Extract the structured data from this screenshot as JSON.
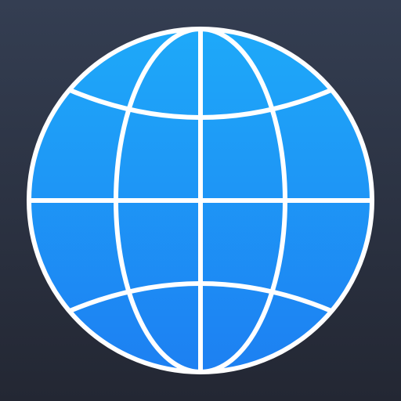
{
  "icon": {
    "name": "globe-icon",
    "colors": {
      "background_top": "#343e52",
      "background_bottom": "#232733",
      "globe_top": "#1ea9f9",
      "globe_bottom": "#1d80f2",
      "grid_lines": "#ffffff"
    }
  }
}
